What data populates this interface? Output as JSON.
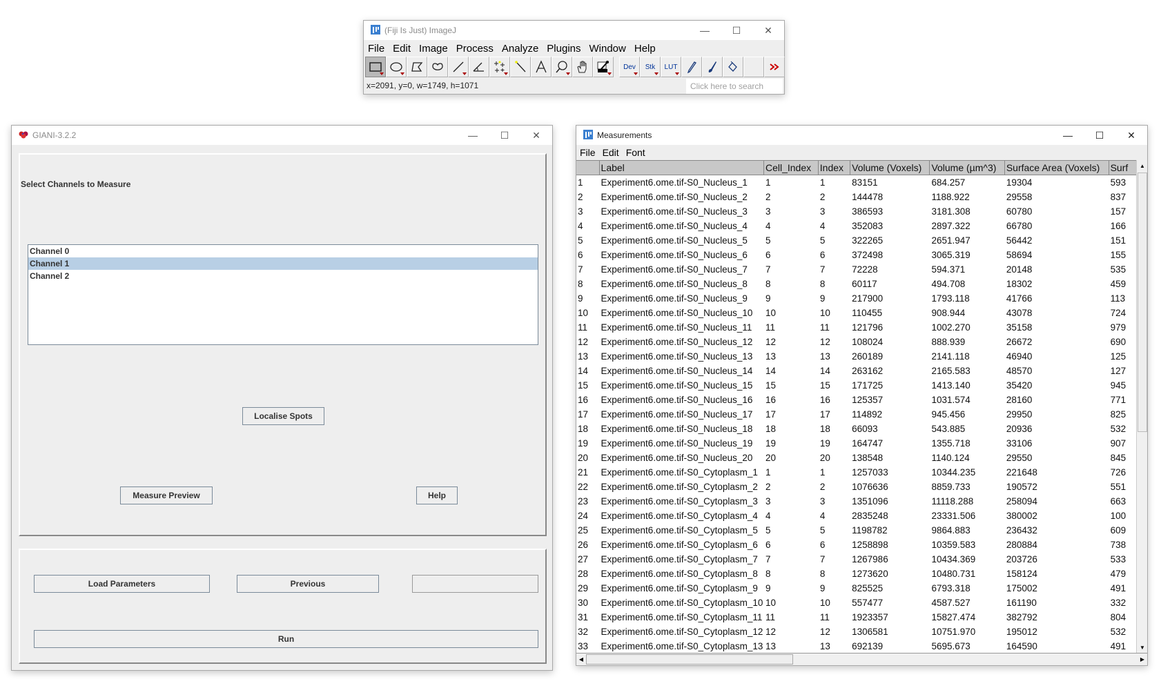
{
  "imagej": {
    "title": "(Fiji Is Just) ImageJ",
    "menu": [
      "File",
      "Edit",
      "Image",
      "Process",
      "Analyze",
      "Plugins",
      "Window",
      "Help"
    ],
    "tools": [
      {
        "name": "rectangle-tool",
        "selected": true,
        "dropdown": true
      },
      {
        "name": "oval-tool",
        "dropdown": true
      },
      {
        "name": "polygon-tool"
      },
      {
        "name": "freehand-tool"
      },
      {
        "name": "line-tool",
        "dropdown": true
      },
      {
        "name": "angle-tool"
      },
      {
        "name": "multipoint-tool",
        "dropdown": true
      },
      {
        "name": "wand-tool"
      },
      {
        "name": "text-tool"
      },
      {
        "name": "magnifier-tool",
        "dropdown": true
      },
      {
        "name": "hand-tool"
      },
      {
        "name": "color-picker-tool",
        "dropdown": true
      }
    ],
    "menu_tools": [
      {
        "name": "dev-menu",
        "label": "Dev"
      },
      {
        "name": "stk-menu",
        "label": "Stk"
      },
      {
        "name": "lut-menu",
        "label": "LUT"
      }
    ],
    "extra_tools": [
      "pencil-tool",
      "brush-tool",
      "flood-fill-tool",
      "empty-slot",
      "more-tools"
    ],
    "status": "x=2091, y=0, w=1749, h=1071",
    "search_placeholder": "Click here to search"
  },
  "giani": {
    "title": "GIANI-3.2.2",
    "section_label": "Select Channels to Measure",
    "channels": [
      {
        "label": "Channel 0",
        "selected": false
      },
      {
        "label": "Channel 1",
        "selected": true
      },
      {
        "label": "Channel 2",
        "selected": false
      }
    ],
    "buttons": {
      "localise": "Localise Spots",
      "measure_preview": "Measure Preview",
      "help": "Help",
      "load_parameters": "Load Parameters",
      "previous": "Previous",
      "next": "",
      "run": "Run"
    }
  },
  "measurements": {
    "title": "Measurements",
    "menu": [
      "File",
      "Edit",
      "Font"
    ],
    "columns": [
      "",
      "Label",
      "Cell_Index",
      "Index",
      "Volume (Voxels)",
      "Volume (µm^3)",
      "Surface Area (Voxels)",
      "Surf"
    ],
    "rows": [
      [
        "1",
        "Experiment6.ome.tif-S0_Nucleus_1",
        "1",
        "1",
        "83151",
        "684.257",
        "19304",
        "593"
      ],
      [
        "2",
        "Experiment6.ome.tif-S0_Nucleus_2",
        "2",
        "2",
        "144478",
        "1188.922",
        "29558",
        "837"
      ],
      [
        "3",
        "Experiment6.ome.tif-S0_Nucleus_3",
        "3",
        "3",
        "386593",
        "3181.308",
        "60780",
        "157"
      ],
      [
        "4",
        "Experiment6.ome.tif-S0_Nucleus_4",
        "4",
        "4",
        "352083",
        "2897.322",
        "66780",
        "166"
      ],
      [
        "5",
        "Experiment6.ome.tif-S0_Nucleus_5",
        "5",
        "5",
        "322265",
        "2651.947",
        "56442",
        "151"
      ],
      [
        "6",
        "Experiment6.ome.tif-S0_Nucleus_6",
        "6",
        "6",
        "372498",
        "3065.319",
        "58694",
        "155"
      ],
      [
        "7",
        "Experiment6.ome.tif-S0_Nucleus_7",
        "7",
        "7",
        "72228",
        "594.371",
        "20148",
        "535"
      ],
      [
        "8",
        "Experiment6.ome.tif-S0_Nucleus_8",
        "8",
        "8",
        "60117",
        "494.708",
        "18302",
        "459"
      ],
      [
        "9",
        "Experiment6.ome.tif-S0_Nucleus_9",
        "9",
        "9",
        "217900",
        "1793.118",
        "41766",
        "113"
      ],
      [
        "10",
        "Experiment6.ome.tif-S0_Nucleus_10",
        "10",
        "10",
        "110455",
        "908.944",
        "43078",
        "724"
      ],
      [
        "11",
        "Experiment6.ome.tif-S0_Nucleus_11",
        "11",
        "11",
        "121796",
        "1002.270",
        "35158",
        "979"
      ],
      [
        "12",
        "Experiment6.ome.tif-S0_Nucleus_12",
        "12",
        "12",
        "108024",
        "888.939",
        "26672",
        "690"
      ],
      [
        "13",
        "Experiment6.ome.tif-S0_Nucleus_13",
        "13",
        "13",
        "260189",
        "2141.118",
        "46940",
        "125"
      ],
      [
        "14",
        "Experiment6.ome.tif-S0_Nucleus_14",
        "14",
        "14",
        "263162",
        "2165.583",
        "48570",
        "127"
      ],
      [
        "15",
        "Experiment6.ome.tif-S0_Nucleus_15",
        "15",
        "15",
        "171725",
        "1413.140",
        "35420",
        "945"
      ],
      [
        "16",
        "Experiment6.ome.tif-S0_Nucleus_16",
        "16",
        "16",
        "125357",
        "1031.574",
        "28160",
        "771"
      ],
      [
        "17",
        "Experiment6.ome.tif-S0_Nucleus_17",
        "17",
        "17",
        "114892",
        "945.456",
        "29950",
        "825"
      ],
      [
        "18",
        "Experiment6.ome.tif-S0_Nucleus_18",
        "18",
        "18",
        "66093",
        "543.885",
        "20936",
        "532"
      ],
      [
        "19",
        "Experiment6.ome.tif-S0_Nucleus_19",
        "19",
        "19",
        "164747",
        "1355.718",
        "33106",
        "907"
      ],
      [
        "20",
        "Experiment6.ome.tif-S0_Nucleus_20",
        "20",
        "20",
        "138548",
        "1140.124",
        "29550",
        "845"
      ],
      [
        "21",
        "Experiment6.ome.tif-S0_Cytoplasm_1",
        "1",
        "1",
        "1257033",
        "10344.235",
        "221648",
        "726"
      ],
      [
        "22",
        "Experiment6.ome.tif-S0_Cytoplasm_2",
        "2",
        "2",
        "1076636",
        "8859.733",
        "190572",
        "551"
      ],
      [
        "23",
        "Experiment6.ome.tif-S0_Cytoplasm_3",
        "3",
        "3",
        "1351096",
        "11118.288",
        "258094",
        "663"
      ],
      [
        "24",
        "Experiment6.ome.tif-S0_Cytoplasm_4",
        "4",
        "4",
        "2835248",
        "23331.506",
        "380002",
        "100"
      ],
      [
        "25",
        "Experiment6.ome.tif-S0_Cytoplasm_5",
        "5",
        "5",
        "1198782",
        "9864.883",
        "236432",
        "609"
      ],
      [
        "26",
        "Experiment6.ome.tif-S0_Cytoplasm_6",
        "6",
        "6",
        "1258898",
        "10359.583",
        "280884",
        "738"
      ],
      [
        "27",
        "Experiment6.ome.tif-S0_Cytoplasm_7",
        "7",
        "7",
        "1267986",
        "10434.369",
        "203726",
        "533"
      ],
      [
        "28",
        "Experiment6.ome.tif-S0_Cytoplasm_8",
        "8",
        "8",
        "1273620",
        "10480.731",
        "158124",
        "479"
      ],
      [
        "29",
        "Experiment6.ome.tif-S0_Cytoplasm_9",
        "9",
        "9",
        "825525",
        "6793.318",
        "175002",
        "491"
      ],
      [
        "30",
        "Experiment6.ome.tif-S0_Cytoplasm_10",
        "10",
        "10",
        "557477",
        "4587.527",
        "161190",
        "332"
      ],
      [
        "31",
        "Experiment6.ome.tif-S0_Cytoplasm_11",
        "11",
        "11",
        "1923357",
        "15827.474",
        "382792",
        "804"
      ],
      [
        "32",
        "Experiment6.ome.tif-S0_Cytoplasm_12",
        "12",
        "12",
        "1306581",
        "10751.970",
        "195012",
        "532"
      ],
      [
        "33",
        "Experiment6.ome.tif-S0_Cytoplasm_13",
        "13",
        "13",
        "692139",
        "5695.673",
        "164590",
        "491"
      ]
    ]
  },
  "window_controls": {
    "minimize": "—",
    "maximize": "☐",
    "close": "✕"
  }
}
